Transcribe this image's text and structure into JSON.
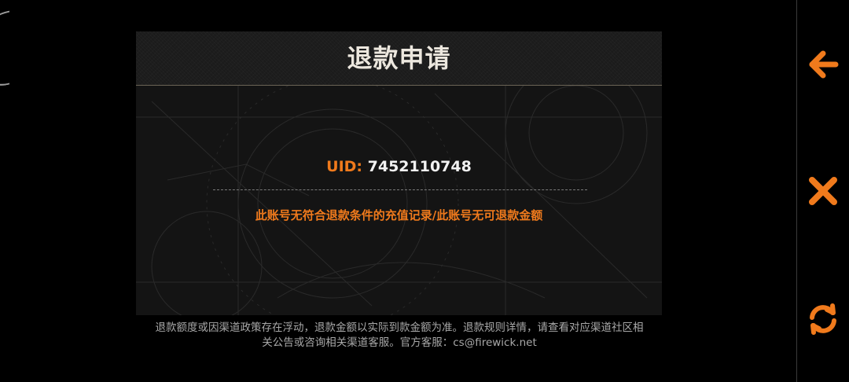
{
  "dialog": {
    "title": "退款申请",
    "uid_label": "UID:",
    "uid_value": "7452110748",
    "message": "此账号无符合退款条件的充值记录/此账号无可退款金额"
  },
  "footer": {
    "line1": "退款额度或因渠道政策存在浮动，退款金额以实际到款金额为准。退款规则详情，请查看对应渠道社区相",
    "line2": "关公告或咨询相关渠道客服。官方客服：cs@firewick.net"
  },
  "side_buttons": {
    "accent_color": "#f07a1c",
    "items": [
      {
        "icon": "arrow-left-icon"
      },
      {
        "icon": "close-icon"
      },
      {
        "icon": "refresh-icon"
      }
    ]
  }
}
